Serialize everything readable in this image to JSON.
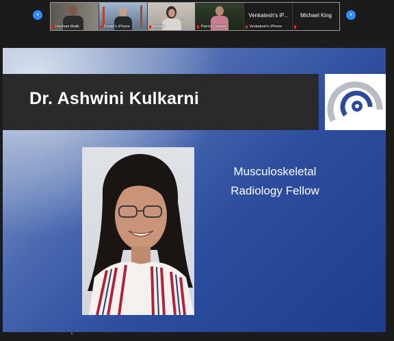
{
  "nav": {
    "prev_icon": "chevron-left-icon",
    "next_icon": "chevron-right-icon"
  },
  "participants": [
    {
      "name": "Hesham Malik",
      "muted": true,
      "video": true
    },
    {
      "name": "Daniel's iPhone",
      "muted": true,
      "video": true
    },
    {
      "name": "Ashwini",
      "muted": true,
      "video": true
    },
    {
      "name": "Patrick Laurent -",
      "muted": true,
      "video": true
    },
    {
      "name": "Venkatesh's iPhone",
      "display": "Venkatesh's iP...",
      "muted": true,
      "video": false
    },
    {
      "name": "Michael King",
      "display": "Michael King",
      "muted": true,
      "video": false
    }
  ],
  "slide": {
    "title": "Dr. Ashwini Kulkarni",
    "subtitle_line1": "Musculoskeletal",
    "subtitle_line2": "Radiology Fellow",
    "logo_icon": "radiology-logo-icon"
  },
  "colors": {
    "accent": "#2d8cff",
    "muted_mic": "#e02828",
    "title_bar": "#2a2a2a",
    "logo_blue": "#2d4a9a",
    "logo_gray": "#b8bcc4"
  }
}
